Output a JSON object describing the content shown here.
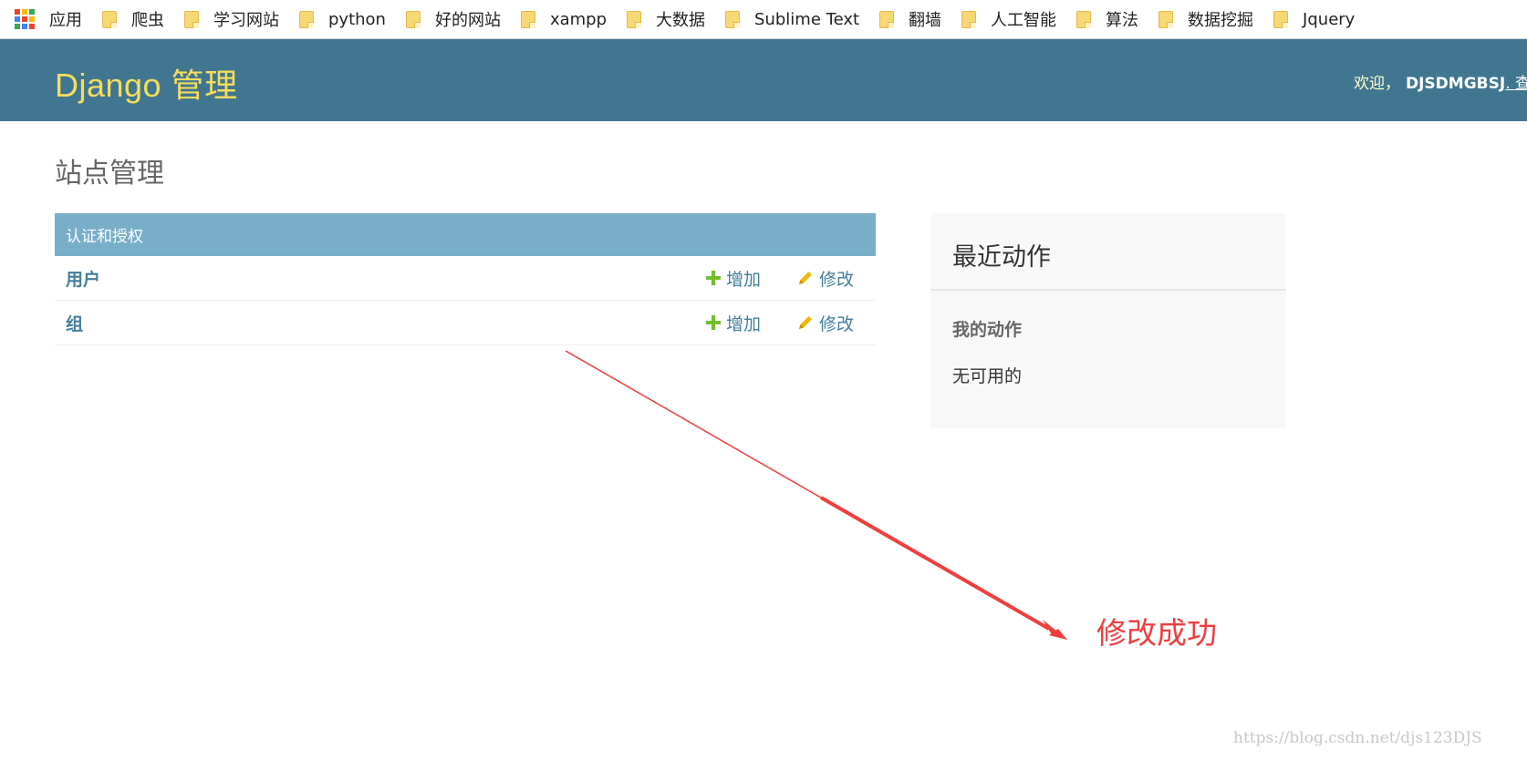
{
  "bookmarks": {
    "apps_label": "应用",
    "items": [
      "爬虫",
      "学习网站",
      "python",
      "好的网站",
      "xampp",
      "大数据",
      "Sublime Text",
      "翻墙",
      "人工智能",
      "算法",
      "数据挖掘",
      "Jquery"
    ]
  },
  "header": {
    "site_title": "Django 管理",
    "welcome": "欢迎，",
    "username": "DJSDMGBSJ",
    "view_site": ". 查看"
  },
  "content": {
    "page_title": "站点管理",
    "module_caption": "认证和授权",
    "models": [
      {
        "name": "用户",
        "add": "增加",
        "change": "修改"
      },
      {
        "name": "组",
        "add": "增加",
        "change": "修改"
      }
    ]
  },
  "recent_actions": {
    "title": "最近动作",
    "my_actions": "我的动作",
    "none": "无可用的"
  },
  "annotation": {
    "text": "修改成功",
    "color": "#f03e3e"
  },
  "watermark": "https://blog.csdn.net/djs123DJS",
  "colors": {
    "header_bg": "#417690",
    "module_caption_bg": "#79aec8",
    "link": "#447e9b",
    "add_icon": "#70bf2b",
    "change_icon": "#efb80b",
    "title_yellow": "#f5dd5d"
  }
}
